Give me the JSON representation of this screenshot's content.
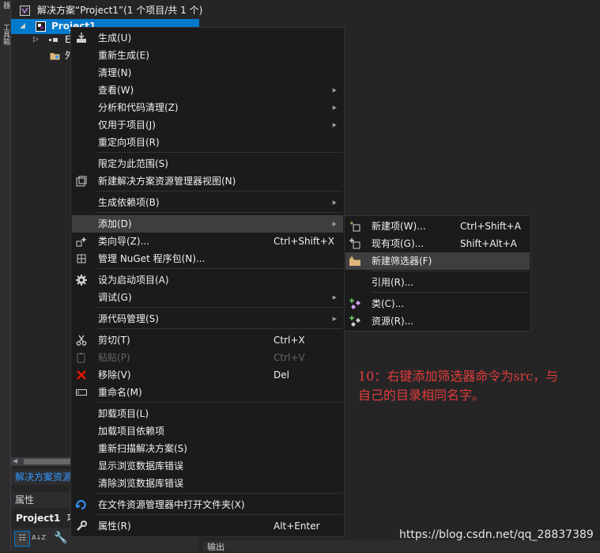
{
  "left_strip": {
    "top": "器",
    "bottom": "工具箱"
  },
  "solution_explorer": {
    "solution_label": "解决方案“Project1”(1 个项目/共 1 个)",
    "project_label": "Project1",
    "child1_label": "E",
    "child2_label": "外",
    "tab_label": "解决方案资源"
  },
  "properties": {
    "header": "属性",
    "object_name": "Project1",
    "object_suffix": "项",
    "toolbar_sort_label": "A↓Z"
  },
  "output_header": "输出",
  "context_menu": {
    "items": [
      {
        "label": "生成(U)",
        "icon": "build-icon"
      },
      {
        "label": "重新生成(E)"
      },
      {
        "label": "清理(N)"
      },
      {
        "label": "查看(W)",
        "submenu": true
      },
      {
        "label": "分析和代码清理(Z)",
        "submenu": true
      },
      {
        "label": "仅用于项目(J)",
        "submenu": true
      },
      {
        "label": "重定向项目(R)"
      },
      {
        "label": "限定为此范围(S)"
      },
      {
        "label": "新建解决方案资源管理器视图(N)",
        "icon": "new-view-icon"
      },
      {
        "label": "生成依赖项(B)",
        "submenu": true
      },
      {
        "label": "添加(D)",
        "submenu": true,
        "highlighted": true
      },
      {
        "label": "类向导(Z)...",
        "shortcut": "Ctrl+Shift+X",
        "icon": "class-wizard-icon"
      },
      {
        "label": "管理 NuGet 程序包(N)...",
        "icon": "nuget-icon"
      },
      {
        "label": "设为启动项目(A)",
        "icon": "gear-icon"
      },
      {
        "label": "调试(G)",
        "submenu": true
      },
      {
        "label": "源代码管理(S)",
        "submenu": true
      },
      {
        "label": "剪切(T)",
        "shortcut": "Ctrl+X",
        "icon": "scissors-icon"
      },
      {
        "label": "粘贴(P)",
        "shortcut": "Ctrl+V",
        "icon": "paste-icon",
        "disabled": true
      },
      {
        "label": "移除(V)",
        "shortcut": "Del",
        "icon": "remove-icon"
      },
      {
        "label": "重命名(M)",
        "icon": "rename-icon"
      },
      {
        "label": "卸载项目(L)"
      },
      {
        "label": "加载项目依赖项"
      },
      {
        "label": "重新扫描解决方案(S)"
      },
      {
        "label": "显示浏览数据库错误"
      },
      {
        "label": "清除浏览数据库错误"
      },
      {
        "label": "在文件资源管理器中打开文件夹(X)",
        "icon": "open-folder-icon"
      },
      {
        "label": "属性(R)",
        "shortcut": "Alt+Enter",
        "icon": "wrench-icon"
      }
    ]
  },
  "submenu": {
    "items": [
      {
        "label": "新建项(W)...",
        "shortcut": "Ctrl+Shift+A",
        "icon": "new-item-icon"
      },
      {
        "label": "现有项(G)...",
        "shortcut": "Shift+Alt+A",
        "icon": "existing-item-icon"
      },
      {
        "label": "新建筛选器(F)",
        "icon": "new-filter-icon",
        "highlighted": true
      },
      {
        "label": "引用(R)..."
      },
      {
        "label": "类(C)...",
        "icon": "class-icon"
      },
      {
        "label": "资源(R)...",
        "icon": "resource-icon"
      }
    ]
  },
  "annotation": {
    "line1": "10：右键添加筛选器命令为src，与",
    "line2": "自己的目录相同名字。"
  },
  "watermark": "https://blog.csdn.net/qq_28837389",
  "colors": {
    "accent": "#007acc",
    "menu_bg": "#1b1b1c",
    "highlight": "#3e3e40",
    "annotation": "#e03c3c"
  }
}
